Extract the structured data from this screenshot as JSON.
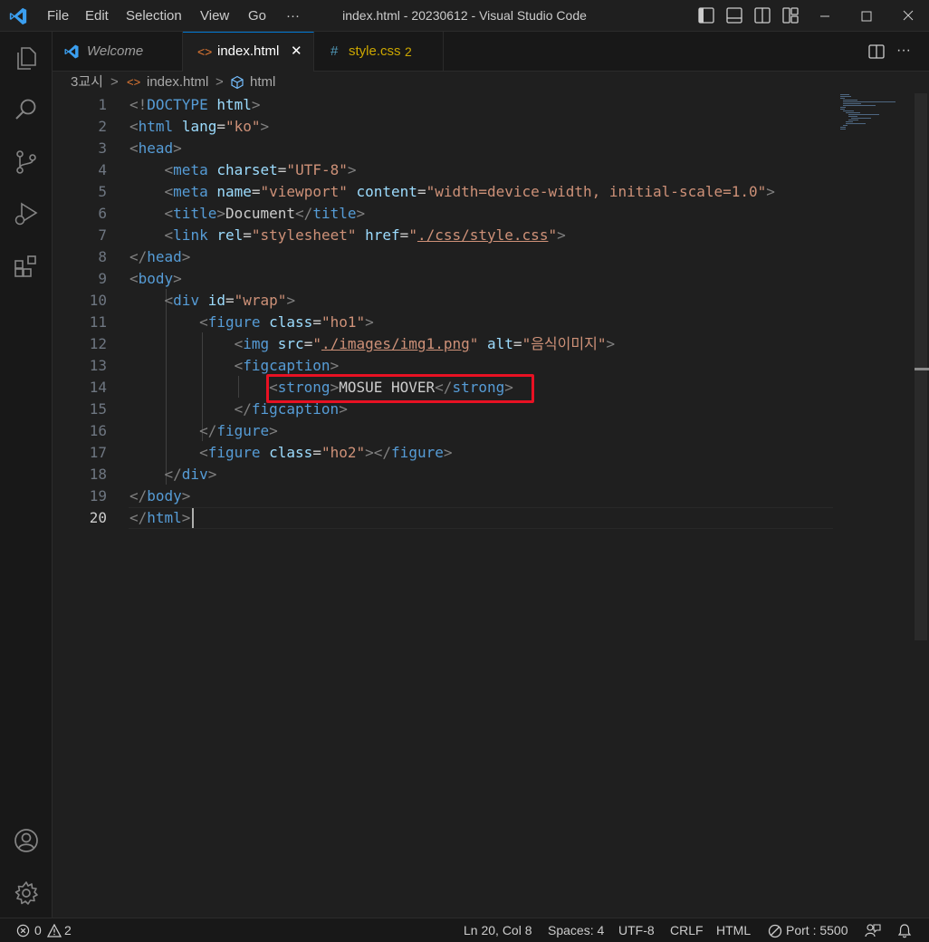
{
  "titlebar": {
    "menu": [
      "File",
      "Edit",
      "Selection",
      "View",
      "Go",
      "···"
    ],
    "title": "index.html - 20230612 - Visual Studio Code",
    "icons": [
      "toggle-primary-sidebar-icon",
      "toggle-panel-icon",
      "toggle-secondary-sidebar-icon",
      "customize-layout-icon"
    ],
    "window_controls": [
      "minimize-icon",
      "maximize-icon",
      "close-icon"
    ]
  },
  "activitybar": {
    "items": [
      "explorer-icon",
      "search-icon",
      "source-control-icon",
      "run-and-debug-icon",
      "extensions-icon"
    ],
    "bottom": [
      "accounts-icon",
      "manage-gear-icon"
    ]
  },
  "tabs": [
    {
      "label": "Welcome",
      "icon": "vscode-icon",
      "italic": true
    },
    {
      "label": "index.html",
      "icon": "<>",
      "active": true,
      "close": "✕"
    },
    {
      "label": "style.css",
      "icon": "#",
      "badge": "2"
    }
  ],
  "breadcrumb": {
    "items": [
      "3교시",
      "index.html",
      "html"
    ],
    "separator": ">"
  },
  "editor": {
    "line_numbers": [
      "1",
      "2",
      "3",
      "4",
      "5",
      "6",
      "7",
      "8",
      "9",
      "10",
      "11",
      "12",
      "13",
      "14",
      "15",
      "16",
      "17",
      "18",
      "19",
      "20"
    ],
    "current_line": "20",
    "lines": [
      "<!DOCTYPE html>",
      "<html lang=\"ko\">",
      "<head>",
      "    <meta charset=\"UTF-8\">",
      "    <meta name=\"viewport\" content=\"width=device-width, initial-scale=1.0\">",
      "    <title>Document</title>",
      "    <link rel=\"stylesheet\" href=\"./css/style.css\">",
      "</head>",
      "<body>",
      "    <div id=\"wrap\">",
      "        <figure class=\"ho1\">",
      "            <img src=\"./images/img1.png\" alt=\"음식이미지\">",
      "            <figcaption>",
      "                <strong>MOSUE HOVER</strong>",
      "            </figcaption>",
      "        </figure>",
      "        <figure class=\"ho2\"></figure>",
      "    </div>",
      "</body>",
      "</html>"
    ],
    "highlight_color": "#e81123"
  },
  "statusbar": {
    "errors": "0",
    "warnings": "2",
    "position": "Ln 20, Col 8",
    "spaces": "Spaces: 4",
    "encoding": "UTF-8",
    "eol": "CRLF",
    "language": "HTML",
    "port": "Port : 5500"
  },
  "colors": {
    "accent": "#0078d4",
    "tag": "#569cd6",
    "attribute": "#9cdcfe",
    "string": "#ce9178",
    "warning_tab": "#cca700"
  }
}
